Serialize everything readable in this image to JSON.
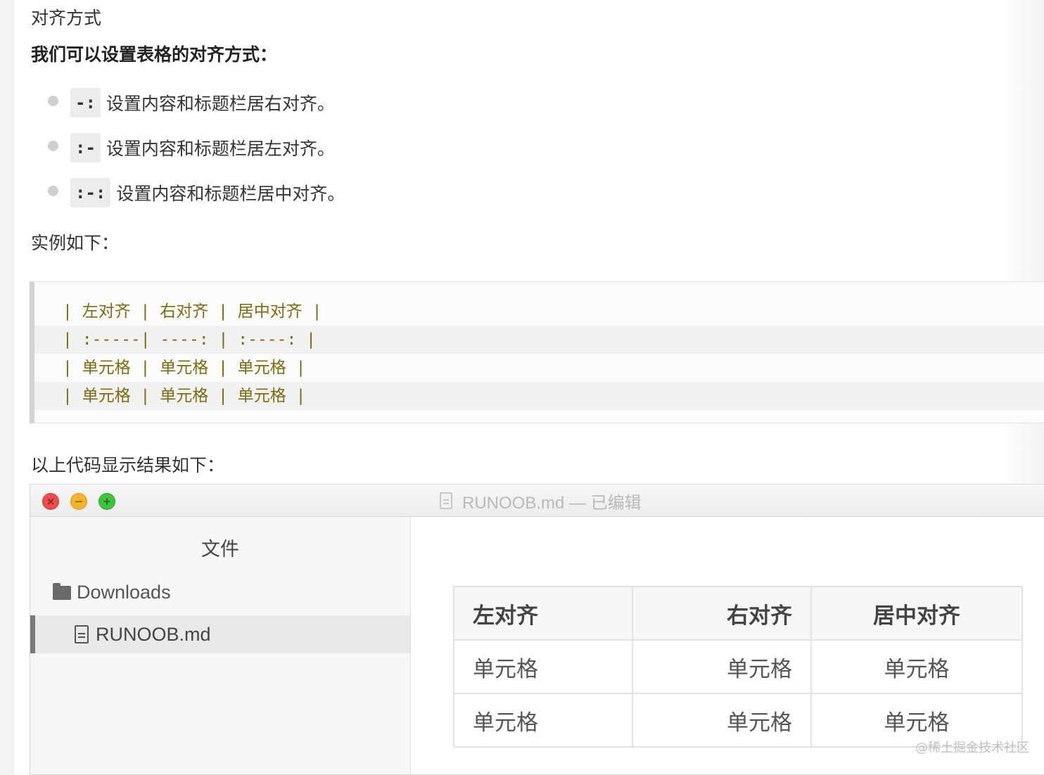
{
  "section_title": "对齐方式",
  "intro": "我们可以设置表格的对齐方式：",
  "bullets": [
    {
      "code": "-:",
      "text": "设置内容和标题栏居右对齐。"
    },
    {
      "code": ":-",
      "text": "设置内容和标题栏居左对齐。"
    },
    {
      "code": ":-:",
      "text": "设置内容和标题栏居中对齐。"
    }
  ],
  "example_label": "实例如下：",
  "code_lines": [
    "| 左对齐 | 右对齐 | 居中对齐 |",
    "| :-----| ----: | :----: |",
    "| 单元格 | 单元格 | 单元格 |",
    "| 单元格 | 单元格 | 单元格 |"
  ],
  "result_label": "以上代码显示结果如下：",
  "window": {
    "title": "RUNOOB.md — 已编辑",
    "sidebar_header": "文件",
    "folder": "Downloads",
    "file": "RUNOOB.md",
    "controls": {
      "close": "×",
      "minimize": "−",
      "zoom": "+"
    },
    "colors": {
      "close": "#ee4c4a",
      "minimize": "#f5b52a",
      "zoom": "#3ec43e"
    }
  },
  "preview_table": {
    "headers": [
      "左对齐",
      "右对齐",
      "居中对齐"
    ],
    "rows": [
      [
        "单元格",
        "单元格",
        "单元格"
      ],
      [
        "单元格",
        "单元格",
        "单元格"
      ]
    ]
  },
  "watermark": "@稀土掘金技术社区",
  "colors": {
    "code_text": "#7c6b12",
    "bullet": "#cfcfcf"
  }
}
